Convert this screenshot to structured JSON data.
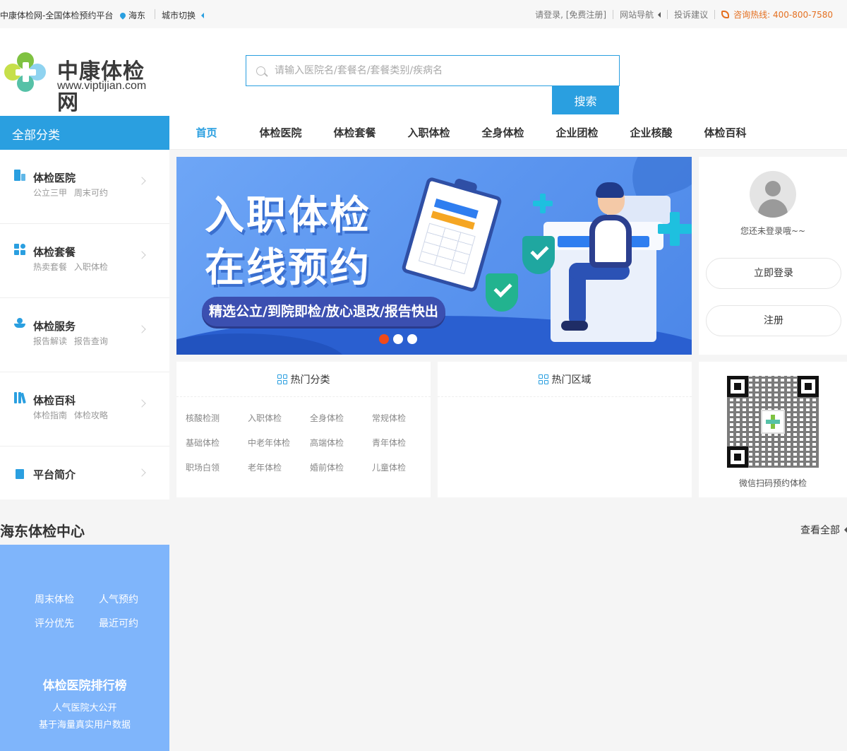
{
  "topbar": {
    "site_name": "中康体检网-全国体检预约平台",
    "location": "海东",
    "city_switch": "城市切换",
    "login_register": "请登录, [免费注册]",
    "site_nav": "网站导航",
    "complaint": "投诉建议",
    "hotline": "咨询热线: 400-800-7580"
  },
  "header": {
    "logo_text": "中康体检网",
    "logo_url": "www.viptijian.com",
    "search_placeholder": "请输入医院名/套餐名/套餐类别/疾病名",
    "search_button": "搜索"
  },
  "nav": {
    "all_categories": "全部分类",
    "items": [
      "首页",
      "体检医院",
      "体检套餐",
      "入职体检",
      "全身体检",
      "企业团检",
      "企业核酸",
      "体检百科"
    ]
  },
  "sidebar": {
    "items": [
      {
        "title": "体检医院",
        "sub": "公立三甲 周末可约",
        "icon": "hospital-icon"
      },
      {
        "title": "体检套餐",
        "sub": "热卖套餐 入职体检",
        "icon": "package-icon"
      },
      {
        "title": "体检服务",
        "sub": "报告解读 报告查询",
        "icon": "service-icon"
      },
      {
        "title": "体检百科",
        "sub": "体检指南 体检攻略",
        "icon": "books-icon"
      },
      {
        "title": "平台简介",
        "sub": "",
        "icon": "platform-icon"
      }
    ]
  },
  "banner": {
    "line1": "入职体检",
    "line2": "在线预约",
    "tagline": "精选公立/到院即检/放心退改/报告快出",
    "active_slide": 1,
    "slide_count": 3
  },
  "user": {
    "status": "您还未登录哦~~",
    "login_button": "立即登录",
    "register_button": "注册"
  },
  "hot_category": {
    "title": "热门分类",
    "items": [
      "核酸检测",
      "入职体检",
      "全身体检",
      "常规体检",
      "基础体检",
      "中老年体检",
      "高端体检",
      "青年体检",
      "职场白领",
      "老年体检",
      "婚前体检",
      "儿童体检"
    ]
  },
  "hot_area": {
    "title": "热门区域"
  },
  "qr": {
    "caption": "微信扫码预约体检"
  },
  "section": {
    "title": "海东体检中心",
    "see_all": "查看全部",
    "quick_links": [
      "周末体检",
      "人气预约",
      "评分优先",
      "最近可约"
    ],
    "rank_title": "体检医院排行榜",
    "rank_sub1": "人气医院大公开",
    "rank_sub2": "基于海量真实用户数据"
  },
  "colors": {
    "brand": "#2a9fe0",
    "hotline": "#e47021",
    "dot_active": "#f04a1a",
    "panel_blue": "#7fb5fb"
  }
}
